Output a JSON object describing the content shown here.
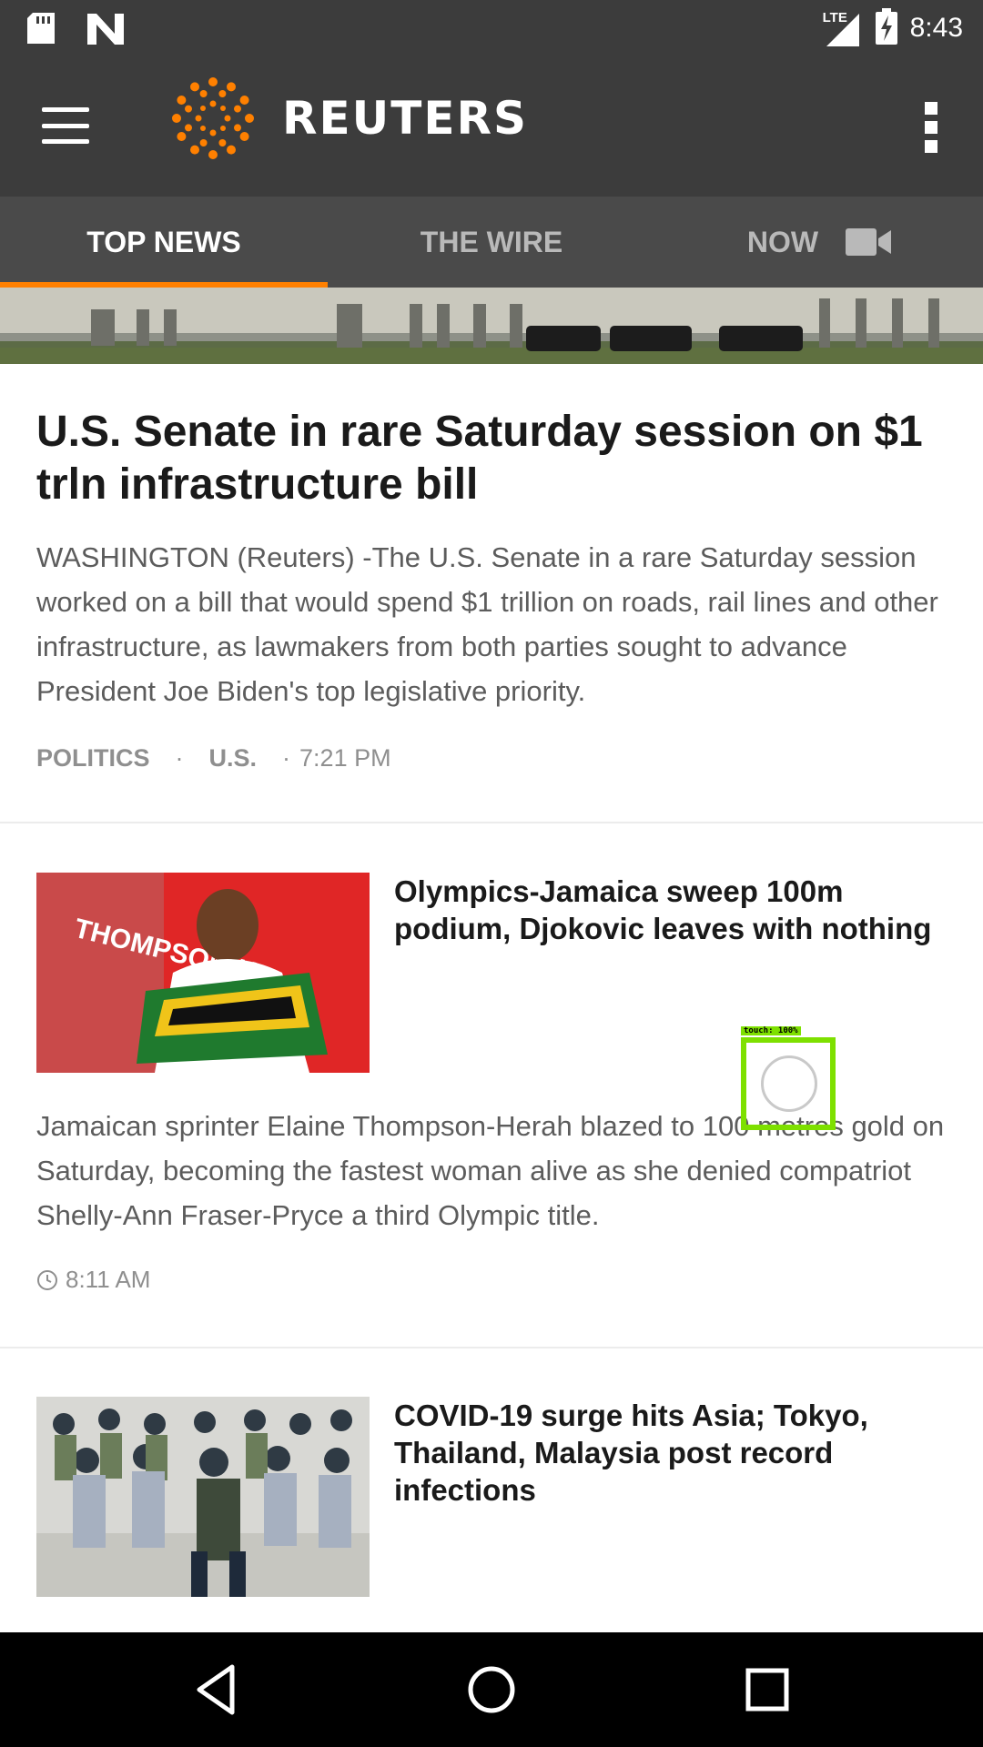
{
  "status_bar": {
    "network": "LTE",
    "time": "8:43",
    "icons": [
      "sd-card-icon",
      "n-app-icon",
      "lte-signal-icon",
      "battery-charging-icon"
    ]
  },
  "app_bar": {
    "logo_text": "REUTERS",
    "icons": [
      "menu-icon",
      "reuters-logo-icon",
      "overflow-menu-icon"
    ]
  },
  "tabs": [
    {
      "label": "TOP NEWS",
      "active": true
    },
    {
      "label": "THE WIRE",
      "active": false
    },
    {
      "label": "NOW",
      "active": false,
      "icon": "video-camera-icon"
    }
  ],
  "accent_color": "#ff8000",
  "top_story": {
    "headline": "U.S. Senate in rare Saturday session on $1 trln infrastructure bill",
    "summary": "WASHINGTON (Reuters) -The U.S. Senate in a rare Saturday session worked on a bill that would spend $1 trillion on roads, rail lines and other infrastructure, as lawmakers from both parties sought to advance President Joe Biden's top legislative priority.",
    "tags": [
      "POLITICS",
      "U.S."
    ],
    "time": "7:21 PM"
  },
  "stories": [
    {
      "headline": "Olympics-Jamaica sweep 100m podium, Djokovic leaves with nothing",
      "summary": "   Jamaican sprinter Elaine Thompson-Herah blazed to 100 metres gold on Saturday, becoming the fastest woman alive as she denied compatriot Shelly-Ann Fraser-Pryce a third Olympic title.",
      "time": "8:11 AM",
      "thumb_text": "THOMPSON-H"
    },
    {
      "headline": "COVID-19 surge hits Asia; Tokyo, Thailand, Malaysia post record infections"
    }
  ],
  "touch_overlay": {
    "label": "touch: 100%"
  },
  "nav_bar": {
    "icons": [
      "back-icon",
      "home-icon",
      "recents-icon"
    ]
  }
}
